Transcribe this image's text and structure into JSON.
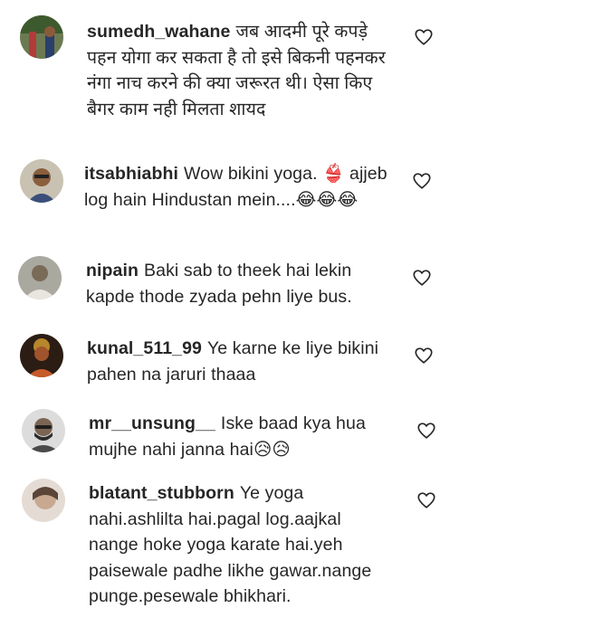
{
  "comments": [
    {
      "username": "sumedh_wahane",
      "text": "जब आदमी पूरे कपड़े पहन योगा कर सकता है तो इसे बिकनी पहनकर नंगा नाच करने की क्या जरूरत थी। ऐसा किए बैगर काम नही मिलता शायद"
    },
    {
      "username": "itsabhiabhi",
      "text": "Wow bikini yoga. 👙 ajjeb log hain Hindustan mein....😂😂😂"
    },
    {
      "username": "nipain",
      "text": "Baki sab to theek hai lekin kapde thode zyada pehn liye bus."
    },
    {
      "username": "kunal_511_99",
      "text": "Ye karne ke liye bikini pahen na jaruri thaaa"
    },
    {
      "username": "mr__unsung__",
      "text": "Iske baad kya hua mujhe nahi janna hai😥😥"
    },
    {
      "username": "blatant_stubborn",
      "text": "Ye yoga nahi.ashlilta hai.pagal log.aajkal nange hoke yoga karate hai.yeh paisewale padhe likhe gawar.nange punge.pesewale bhikhari."
    }
  ],
  "icons": {
    "like": "heart-outline-icon"
  }
}
